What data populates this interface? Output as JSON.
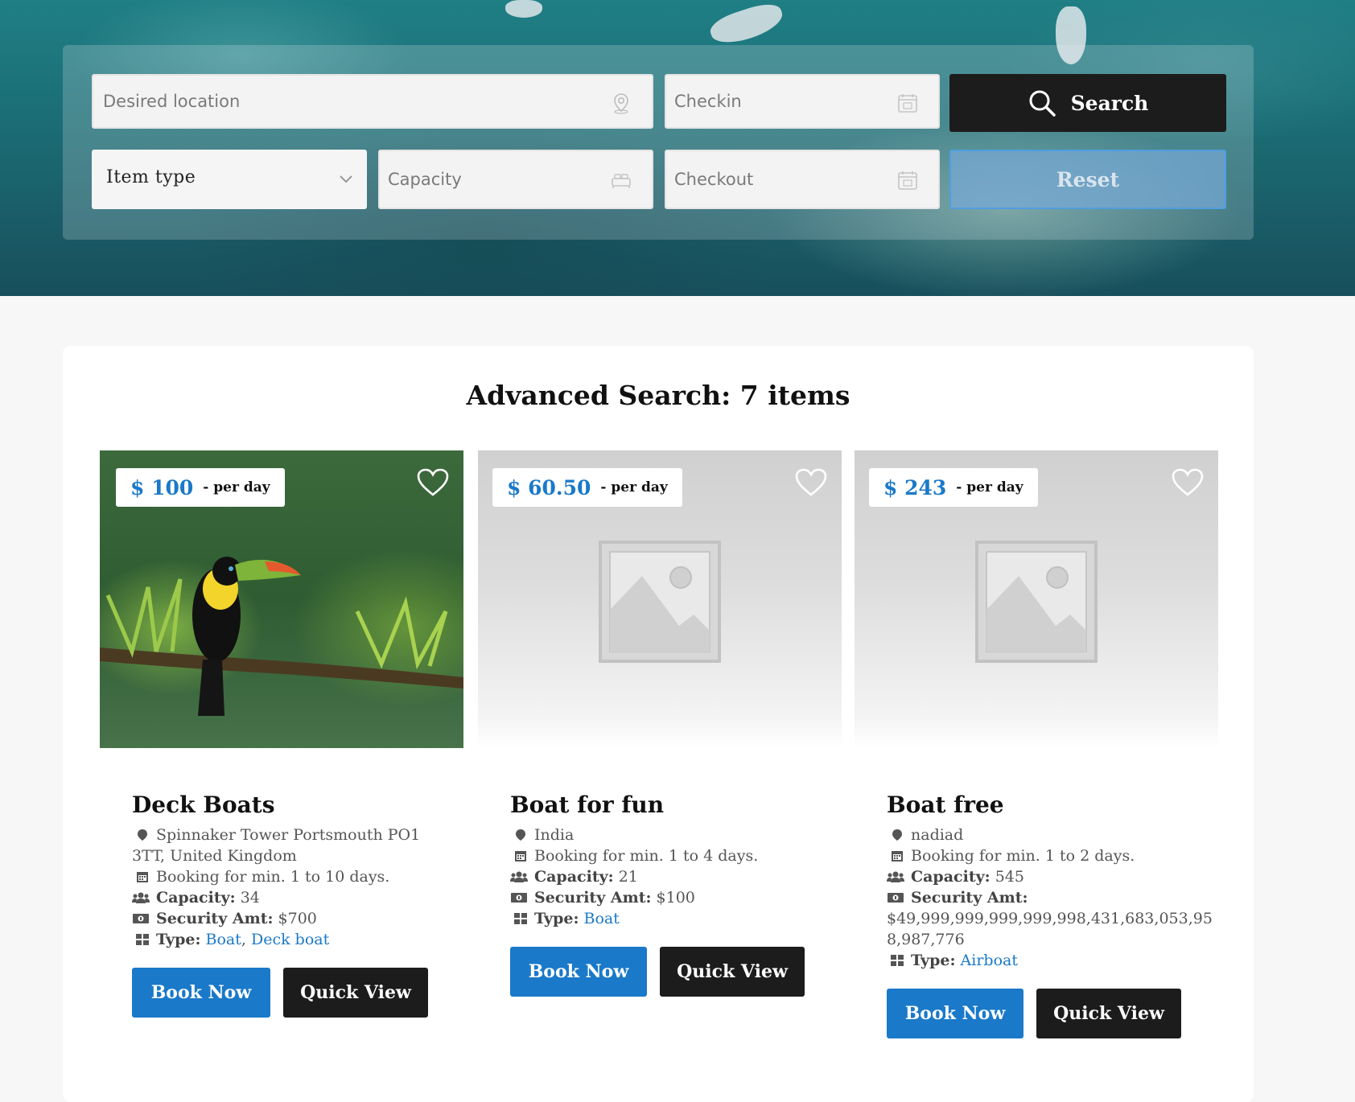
{
  "search": {
    "location_placeholder": "Desired location",
    "checkin_placeholder": "Checkin",
    "checkout_placeholder": "Checkout",
    "capacity_placeholder": "Capacity",
    "item_type_value": "Item type",
    "search_label": "Search",
    "reset_label": "Reset"
  },
  "results": {
    "heading": "Advanced Search: 7 items",
    "items": [
      {
        "price": "$ 100",
        "per": "- per day",
        "title": "Deck Boats",
        "location": "Spinnaker Tower Portsmouth PO1 3TT, United Kingdom",
        "booking": "Booking for min. 1 to 10 days.",
        "capacity_label": "Capacity:",
        "capacity": "34",
        "security_label": "Security Amt:",
        "security": "$700",
        "type_label": "Type:",
        "types": [
          "Boat",
          "Deck boat"
        ],
        "book_label": "Book Now",
        "quick_label": "Quick View"
      },
      {
        "price": "$ 60.50",
        "per": "- per day",
        "title": "Boat for fun",
        "location": "India",
        "booking": "Booking for min. 1 to 4 days.",
        "capacity_label": "Capacity:",
        "capacity": "21",
        "security_label": "Security Amt:",
        "security": "$100",
        "type_label": "Type:",
        "types": [
          "Boat"
        ],
        "book_label": "Book Now",
        "quick_label": "Quick View"
      },
      {
        "price": "$ 243",
        "per": "- per day",
        "title": "Boat free",
        "location": "nadiad",
        "booking": "Booking for min. 1 to 2 days.",
        "capacity_label": "Capacity:",
        "capacity": "545",
        "security_label": "Security Amt:",
        "security": "$49,999,999,999,999,998,431,683,053,958,987,776",
        "type_label": "Type:",
        "types": [
          "Airboat"
        ],
        "book_label": "Book Now",
        "quick_label": "Quick View"
      }
    ]
  },
  "colors": {
    "accent": "#1a79c9",
    "dark_button": "#1c1c1c",
    "reset_button": "#7aaad7"
  },
  "icons": [
    "location-pin-icon",
    "calendar-icon",
    "bed-icon",
    "chevron-down-icon",
    "search-icon",
    "heart-icon",
    "map-marker-icon",
    "users-icon",
    "money-icon",
    "grid-icon",
    "image-placeholder-icon"
  ]
}
